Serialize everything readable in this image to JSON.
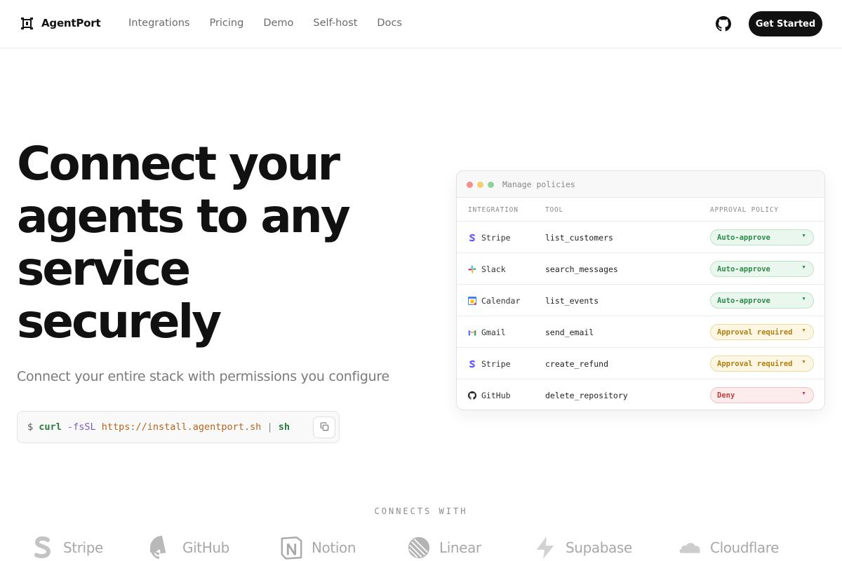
{
  "nav": {
    "brand": "AgentPort",
    "links": [
      "Integrations",
      "Pricing",
      "Demo",
      "Self-host",
      "Docs"
    ],
    "github_icon": "github-icon",
    "cta": "Get Started"
  },
  "hero": {
    "title_lines": [
      "Connect your",
      "agents to any",
      "service",
      "securely"
    ],
    "subtitle": "Connect your entire stack with permissions you configure",
    "install": {
      "dollar": "$",
      "cmd": "curl",
      "flag": "-fsSL",
      "url": "https://install.agentport.sh",
      "pipe": "|",
      "shell": "sh",
      "copy_icon": "copy-icon"
    }
  },
  "panel": {
    "title": "Manage policies",
    "columns": [
      "INTEGRATION",
      "TOOL",
      "APPROVAL POLICY"
    ],
    "rows": [
      {
        "service": "Stripe",
        "icon": "stripe-icon",
        "tool": "list_customers",
        "policy": "Auto-approve",
        "kind": "green"
      },
      {
        "service": "Slack",
        "icon": "slack-icon",
        "tool": "search_messages",
        "policy": "Auto-approve",
        "kind": "green"
      },
      {
        "service": "Calendar",
        "icon": "calendar-icon",
        "tool": "list_events",
        "policy": "Auto-approve",
        "kind": "green"
      },
      {
        "service": "Gmail",
        "icon": "gmail-icon",
        "tool": "send_email",
        "policy": "Approval required",
        "kind": "yellow"
      },
      {
        "service": "Stripe",
        "icon": "stripe-icon",
        "tool": "create_refund",
        "policy": "Approval required",
        "kind": "yellow"
      },
      {
        "service": "GitHub",
        "icon": "github-icon",
        "tool": "delete_repository",
        "policy": "Deny",
        "kind": "red"
      }
    ],
    "dot_colors": [
      "#f1908c",
      "#f3cf6e",
      "#8fd19e"
    ]
  },
  "connects": {
    "label": "CONNECTS WITH",
    "logos": [
      {
        "name": "Stripe",
        "icon": "stripe-logo-icon"
      },
      {
        "name": "GitHub",
        "icon": "github-logo-icon"
      },
      {
        "name": "Notion",
        "icon": "notion-logo-icon"
      },
      {
        "name": "Linear",
        "icon": "linear-logo-icon"
      },
      {
        "name": "Supabase",
        "icon": "supabase-logo-icon"
      },
      {
        "name": "Cloudflare",
        "icon": "cloudflare-logo-icon"
      }
    ]
  }
}
